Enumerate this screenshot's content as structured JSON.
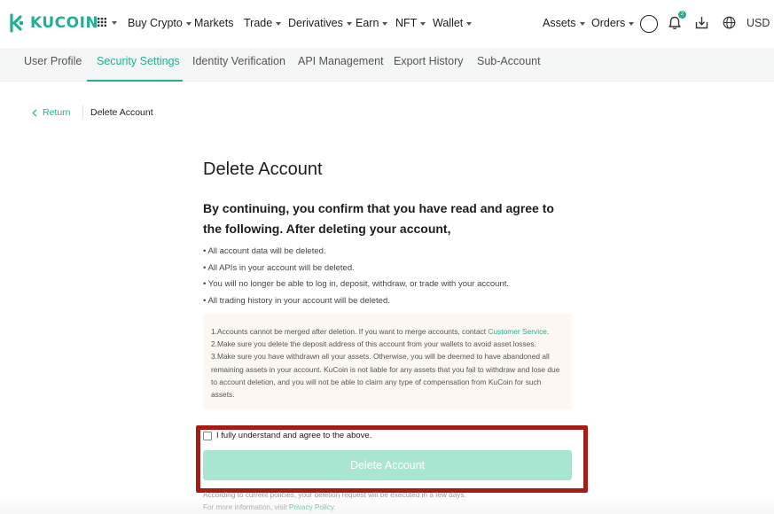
{
  "brand": {
    "name": "KUCOIN",
    "accent": "#23af91"
  },
  "topnav": {
    "items": [
      {
        "label": "Buy Crypto",
        "dropdown": true
      },
      {
        "label": "Markets",
        "dropdown": false
      },
      {
        "label": "Trade",
        "dropdown": true
      },
      {
        "label": "Derivatives",
        "dropdown": true
      },
      {
        "label": "Earn",
        "dropdown": true
      },
      {
        "label": "NFT",
        "dropdown": true
      },
      {
        "label": "Wallet",
        "dropdown": true
      }
    ],
    "assets": "Assets",
    "orders": "Orders",
    "notification_count": "2",
    "currency": "USD"
  },
  "subnav": {
    "tabs": [
      {
        "label": "User Profile",
        "active": false
      },
      {
        "label": "Security Settings",
        "active": true
      },
      {
        "label": "Identity Verification",
        "active": false
      },
      {
        "label": "API Management",
        "active": false
      },
      {
        "label": "Export History",
        "active": false
      },
      {
        "label": "Sub-Account",
        "active": false
      }
    ]
  },
  "breadcrumb": {
    "return_label": "Return",
    "current": "Delete Account"
  },
  "main": {
    "title": "Delete Account",
    "lead": "By continuing, you confirm that you have read and agree to the following. After deleting your account,",
    "bullets": [
      "All account data will be deleted.",
      "All APIs in your account will be deleted.",
      "You will no longer be able to log in, deposit, withdraw, or trade with your account.",
      "All trading history in your account will be deleted."
    ],
    "notice": {
      "line1_prefix": "1.Accounts cannot be merged after deletion. If you want to merge accounts, contact ",
      "line1_link": "Customer Service",
      "line1_suffix": ".",
      "line2": "2.Make sure you delete the deposit address of this account from your wallets to avoid asset losses.",
      "line3": "3.Make sure you have withdrawn all your assets. Otherwise, you will be deemed to have abandoned all remaining assets in your account. KuCoin is not liable for any assets that you fail to withdraw and lose due to account deletion, and you will not be able to claim any type of compensation from KuCoin for such assets."
    },
    "agree_label": "I fully understand and agree to the above.",
    "delete_button": "Delete Account",
    "footnote1": "According to current policies, your deletion request will be executed in a few days.",
    "footnote2_prefix": "For more information, visit ",
    "footnote2_link": "Privacy Policy",
    "footnote2_suffix": "."
  }
}
